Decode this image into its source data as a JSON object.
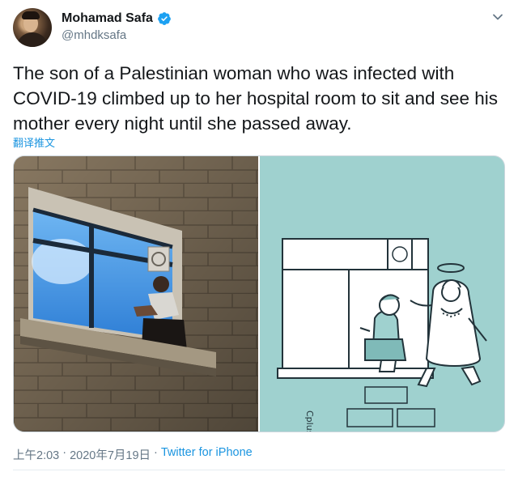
{
  "author": {
    "display_name": "Mohamad Safa",
    "handle": "@mhdksafa",
    "verified": true
  },
  "tweet": {
    "text": "The son of a Palestinian woman who was infected with COVID-19 climbed up to her hospital room to sit and see his mother every night until she passed away.",
    "translate_label": "翻译推文"
  },
  "media": {
    "left": "photo",
    "right": "illustration",
    "illustration_bg": "#9fd1cf",
    "illustration_signature": "Cplus"
  },
  "meta": {
    "time": "上午2:03",
    "date": "2020年7月19日",
    "separator": "·",
    "source": "Twitter for iPhone"
  },
  "colors": {
    "link": "#1b95e0",
    "muted": "#657786",
    "text": "#14171a"
  },
  "icons": {
    "verified": "verified-badge-icon",
    "menu": "chevron-down-icon"
  }
}
